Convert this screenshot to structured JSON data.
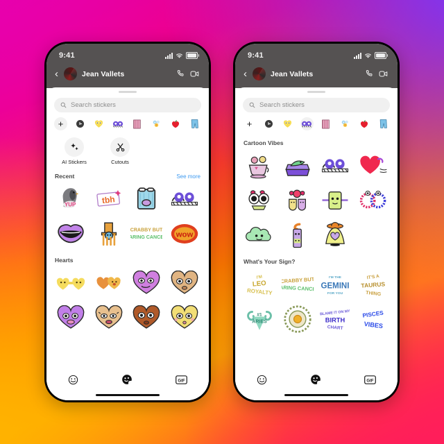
{
  "meta": {
    "background_colors": [
      "#E3009E",
      "#F1007F",
      "#FF3B2E",
      "#FF7A00",
      "#FFA200",
      "#FF1060",
      "#7B36F5"
    ],
    "accent_blue": "#3E9AF0"
  },
  "phones": [
    {
      "id": "phone-left",
      "status": {
        "time": "9:41",
        "cellular": "signal-bars",
        "wifi": "wifi-icon",
        "battery": "battery-icon"
      },
      "header": {
        "back": "‹",
        "username": "Jean Vallets",
        "call_icon": "phone-call-icon",
        "video_icon": "video-call-icon"
      },
      "search": {
        "icon": "search-icon",
        "placeholder": "Search stickers",
        "value": ""
      },
      "tabs": [
        {
          "name": "add-sticker-tab",
          "glyph": "+",
          "selected": true
        },
        {
          "name": "recent-tab",
          "glyph": "clock",
          "selected": false
        },
        {
          "name": "hearts-pack-tab",
          "glyph": "heart-face",
          "selected": false
        },
        {
          "name": "cartoon-vibes-pack-tab",
          "glyph": "glasses-eyes",
          "selected": false
        },
        {
          "name": "popcorn-pack-tab",
          "glyph": "popcorn",
          "selected": false
        },
        {
          "name": "flowers-pack-tab",
          "glyph": "flower-bunch",
          "selected": false
        },
        {
          "name": "apple-pack-tab",
          "glyph": "red-apple",
          "selected": false
        },
        {
          "name": "pants-pack-tab",
          "glyph": "blue-pants",
          "selected": false
        }
      ],
      "quick_actions": [
        {
          "name": "ai-stickers-button",
          "icon": "sparkle-icon",
          "label": "AI Stickers"
        },
        {
          "name": "cutouts-button",
          "icon": "scissors-icon",
          "label": "Cutouts"
        }
      ],
      "sections": [
        {
          "title": "Recent",
          "action": "See more",
          "stickers": [
            {
              "name": "pigeon-yup-sticker",
              "caption": "YUP"
            },
            {
              "name": "tbh-sticker",
              "caption": "tbh"
            },
            {
              "name": "crying-window-sticker",
              "caption": ""
            },
            {
              "name": "purple-eyes-glasses-sticker",
              "caption": ""
            },
            {
              "name": "purple-lips-sticker",
              "caption": ""
            },
            {
              "name": "blue-face-table-sticker",
              "caption": ""
            },
            {
              "name": "crabby-cancer-text-sticker",
              "caption": "CRABBY BUT CARING CANCER"
            },
            {
              "name": "wow-flame-sticker",
              "caption": "WOW"
            }
          ]
        },
        {
          "title": "Hearts",
          "action": "",
          "stickers": [
            {
              "name": "twin-yellow-hearts-sticker",
              "caption": ""
            },
            {
              "name": "orange-hugging-hearts-sticker",
              "caption": ""
            },
            {
              "name": "purple-heart-face-sticker",
              "caption": ""
            },
            {
              "name": "tan-heart-face-sticker",
              "caption": ""
            },
            {
              "name": "violet-heart-lips-sticker",
              "caption": ""
            },
            {
              "name": "tan-heart-lashes-sticker",
              "caption": ""
            },
            {
              "name": "brown-heart-pout-sticker",
              "caption": ""
            },
            {
              "name": "yellow-heart-kiss-sticker",
              "caption": ""
            }
          ]
        }
      ],
      "bottom_bar": [
        {
          "name": "emoji-tab",
          "icon": "emoji-face-icon",
          "active": false
        },
        {
          "name": "sticker-tab",
          "icon": "sticker-icon",
          "active": true
        },
        {
          "name": "gif-tab",
          "icon": "gif-icon",
          "label": "GIF",
          "active": false
        }
      ]
    },
    {
      "id": "phone-right",
      "status": {
        "time": "9:41",
        "cellular": "signal-bars",
        "wifi": "wifi-icon",
        "battery": "battery-icon"
      },
      "header": {
        "back": "‹",
        "username": "Jean Vallets",
        "call_icon": "phone-call-icon",
        "video_icon": "video-call-icon"
      },
      "search": {
        "icon": "search-icon",
        "placeholder": "Search stickers",
        "value": ""
      },
      "tabs": [
        {
          "name": "add-sticker-tab",
          "glyph": "+",
          "selected": false
        },
        {
          "name": "recent-tab",
          "glyph": "clock",
          "selected": false
        },
        {
          "name": "hearts-pack-tab",
          "glyph": "heart-face",
          "selected": false
        },
        {
          "name": "cartoon-vibes-pack-tab",
          "glyph": "glasses-eyes",
          "selected": true
        },
        {
          "name": "popcorn-pack-tab",
          "glyph": "popcorn",
          "selected": false
        },
        {
          "name": "flowers-pack-tab",
          "glyph": "flower-bunch",
          "selected": false
        },
        {
          "name": "apple-pack-tab",
          "glyph": "red-apple",
          "selected": false
        },
        {
          "name": "pants-pack-tab",
          "glyph": "blue-pants",
          "selected": false
        }
      ],
      "quick_actions": [],
      "sections": [
        {
          "title": "Cartoon Vibes",
          "action": "",
          "stickers": [
            {
              "name": "teacup-bears-sticker",
              "caption": ""
            },
            {
              "name": "green-gator-sofa-sticker",
              "caption": ""
            },
            {
              "name": "purple-eyes-glasses-sticker",
              "caption": ""
            },
            {
              "name": "red-heart-arrow-sticker",
              "caption": ""
            },
            {
              "name": "bow-eyes-glasses-sticker",
              "caption": ""
            },
            {
              "name": "candy-teeth-sticker",
              "caption": ""
            },
            {
              "name": "green-phone-face-sticker",
              "caption": ""
            },
            {
              "name": "beaded-hoop-earrings-sticker",
              "caption": ""
            },
            {
              "name": "green-cloud-face-sticker",
              "caption": ""
            },
            {
              "name": "umbrella-face-sticker",
              "caption": ""
            },
            {
              "name": "ghost-hat-heart-sticker",
              "caption": ""
            }
          ]
        },
        {
          "title": "What's Your Sign?",
          "action": "",
          "stickers": [
            {
              "name": "leo-royalty-sticker",
              "caption": "I'M LEO ROYALTY"
            },
            {
              "name": "cancer-sticker",
              "caption": "CRABBY BUT CARING CANCER"
            },
            {
              "name": "gemini-sticker",
              "caption": "I'M THE GEMINI FOR YOU"
            },
            {
              "name": "taurus-sticker",
              "caption": "IT'S A TAURUS THING"
            },
            {
              "name": "aries-sticker",
              "caption": "#1 ARIES"
            },
            {
              "name": "sun-sign-sticker",
              "caption": ""
            },
            {
              "name": "birth-chart-sticker",
              "caption": "BLAME IT ON MY BIRTH CHART"
            },
            {
              "name": "pisces-vibes-sticker",
              "caption": "PISCES VIBES"
            }
          ]
        }
      ],
      "bottom_bar": [
        {
          "name": "emoji-tab",
          "icon": "emoji-face-icon",
          "active": false
        },
        {
          "name": "sticker-tab",
          "icon": "sticker-icon",
          "active": true
        },
        {
          "name": "gif-tab",
          "icon": "gif-icon",
          "label": "GIF",
          "active": false
        }
      ]
    }
  ]
}
